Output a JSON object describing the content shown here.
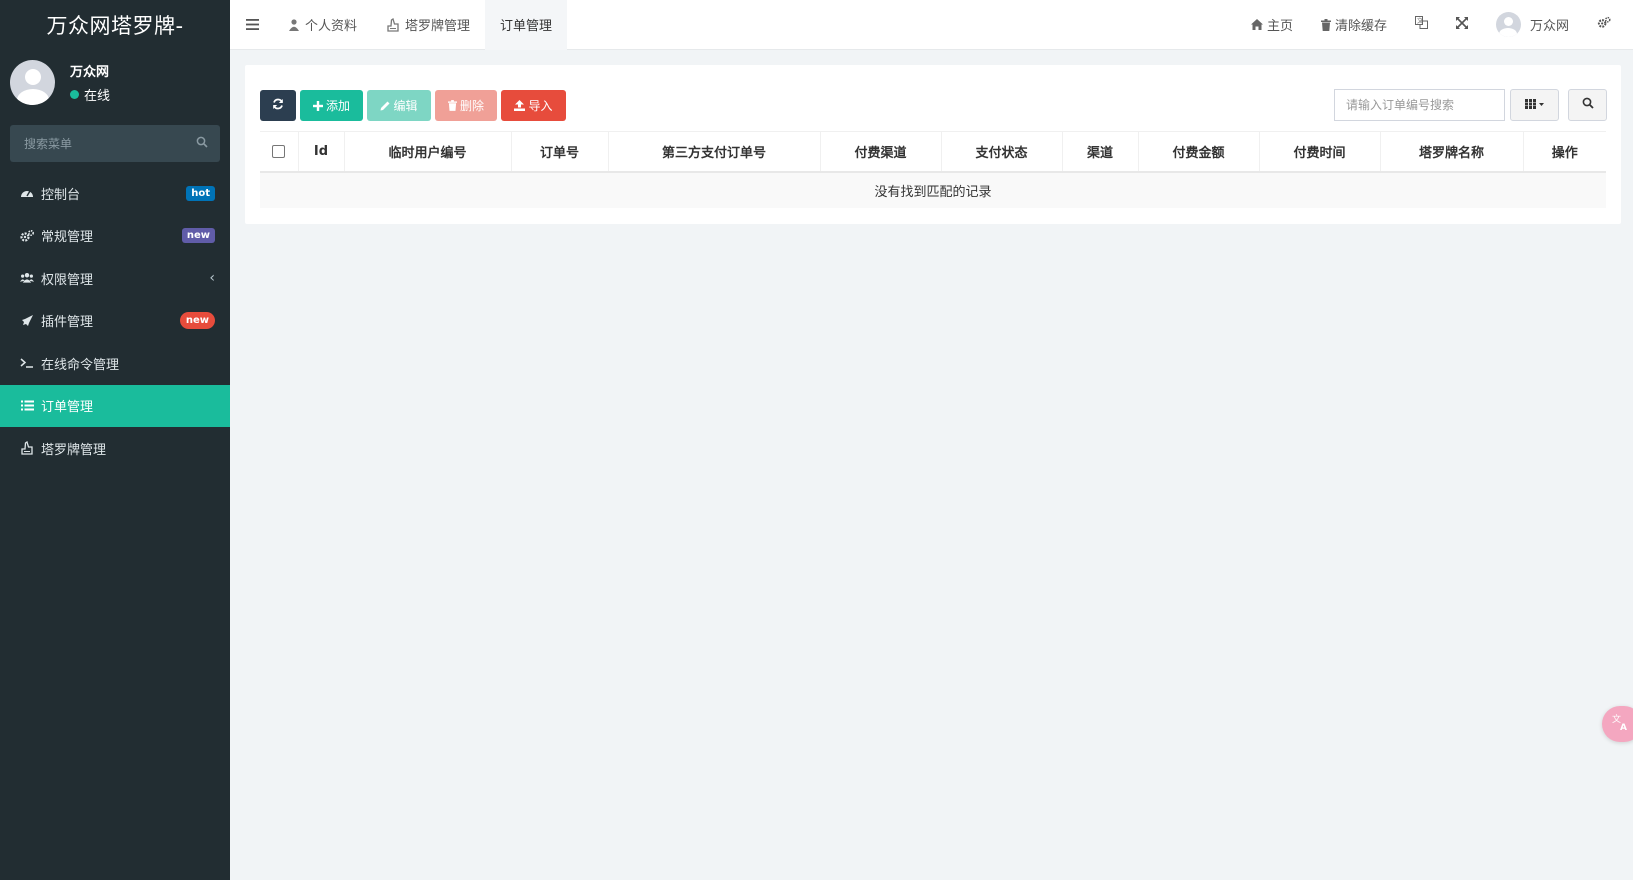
{
  "brand": {
    "title": "万众网塔罗牌-"
  },
  "user": {
    "name": "万众网",
    "status": "在线"
  },
  "sidebar": {
    "search_placeholder": "搜索菜单",
    "items": [
      {
        "label": "控制台",
        "icon": "dashboard-icon",
        "badge": "hot"
      },
      {
        "label": "常规管理",
        "icon": "cogs-icon",
        "badge": "new"
      },
      {
        "label": "权限管理",
        "icon": "users-icon",
        "chevron": "‹"
      },
      {
        "label": "插件管理",
        "icon": "rocket-icon",
        "badge": "new"
      },
      {
        "label": "在线命令管理",
        "icon": "terminal-icon"
      },
      {
        "label": "订单管理",
        "icon": "list-icon",
        "active": true
      },
      {
        "label": "塔罗牌管理",
        "icon": "hand-icon"
      }
    ]
  },
  "header": {
    "tabs": [
      {
        "label": "个人资料",
        "icon": "user-icon"
      },
      {
        "label": "塔罗牌管理",
        "icon": "hand-icon"
      },
      {
        "label": "订单管理",
        "current": true
      }
    ],
    "right": {
      "home": "主页",
      "clear_cache": "清除缓存",
      "username": "万众网"
    }
  },
  "toolbar": {
    "add": "添加",
    "edit": "编辑",
    "delete": "删除",
    "import": "导入"
  },
  "search": {
    "placeholder": "请输入订单编号搜索"
  },
  "table": {
    "columns": [
      "Id",
      "临时用户编号",
      "订单号",
      "第三方支付订单号",
      "付费渠道",
      "支付状态",
      "渠道",
      "付费金额",
      "付费时间",
      "塔罗牌名称",
      "操作"
    ],
    "empty_text": "没有找到匹配的记录"
  },
  "colors": {
    "sidebar_bg": "#222d32",
    "accent": "#1abc9c",
    "danger": "#e74c3c",
    "primary_dark": "#2c3e50"
  }
}
